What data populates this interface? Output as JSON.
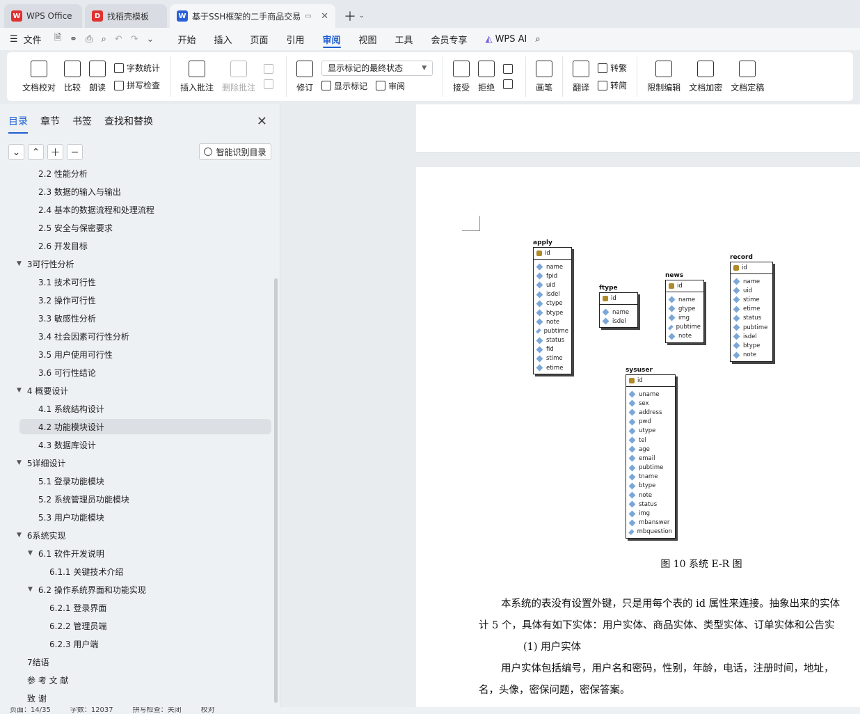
{
  "tabs": [
    {
      "label": "WPS Office",
      "logo": "W",
      "color": "#e0302f"
    },
    {
      "label": "找稻壳模板",
      "logo": "D",
      "color": "#e0302f"
    },
    {
      "label": "基于SSH框架的二手商品交易",
      "logo": "W",
      "color": "#2b5fd9"
    }
  ],
  "menubar": {
    "file": "文件",
    "items": [
      "开始",
      "插入",
      "页面",
      "引用",
      "审阅",
      "视图",
      "工具",
      "会员专享"
    ],
    "active": "审阅",
    "ai": "WPS AI"
  },
  "ribbon": {
    "doc_check": "文档校对",
    "compare": "比较",
    "read_aloud": "朗读",
    "word_count": "字数统计",
    "spell_check": "拼写检查",
    "insert_comment": "插入批注",
    "delete_comment": "删除批注",
    "revise": "修订",
    "display_select": "显示标记的最终状态",
    "show_marks": "显示标记",
    "review": "审阅",
    "accept": "接受",
    "reject": "拒绝",
    "pen": "画笔",
    "translate": "翻译",
    "to_trad": "转繁",
    "to_simp": "转简",
    "restrict_edit": "限制编辑",
    "encrypt": "文档加密",
    "finalize": "文档定稿"
  },
  "sidebar": {
    "tabs": [
      "目录",
      "章节",
      "书签",
      "查找和替换"
    ],
    "smart_button": "智能识别目录",
    "toc": [
      {
        "label": "2.2  性能分析",
        "level": 2
      },
      {
        "label": "2.3  数据的输入与输出",
        "level": 2
      },
      {
        "label": "2.4  基本的数据流程和处理流程",
        "level": 2
      },
      {
        "label": "2.5  安全与保密要求",
        "level": 2
      },
      {
        "label": "2.6  开发目标",
        "level": 2
      },
      {
        "label": "3可行性分析",
        "level": 1,
        "expanded": true
      },
      {
        "label": "3.1 技术可行性",
        "level": 2
      },
      {
        "label": "3.2 操作可行性",
        "level": 2
      },
      {
        "label": "3.3 敏感性分析",
        "level": 2
      },
      {
        "label": "3.4 社会因素可行性分析",
        "level": 2
      },
      {
        "label": "3.5 用户使用可行性",
        "level": 2
      },
      {
        "label": "3.6 可行性结论",
        "level": 2
      },
      {
        "label": "4  概要设计",
        "level": 1,
        "expanded": true
      },
      {
        "label": "4.1 系统结构设计",
        "level": 2
      },
      {
        "label": "4.2 功能模块设计",
        "level": 2,
        "selected": true
      },
      {
        "label": "4.3 数据库设计",
        "level": 2
      },
      {
        "label": "5详细设计",
        "level": 1,
        "expanded": true
      },
      {
        "label": "5.1 登录功能模块",
        "level": 2
      },
      {
        "label": "5.2 系统管理员功能模块",
        "level": 2
      },
      {
        "label": "5.3    用户功能模块",
        "level": 2
      },
      {
        "label": "6系统实现",
        "level": 1,
        "expanded": true
      },
      {
        "label": "6.1    软件开发说明",
        "level": 2,
        "expanded": true
      },
      {
        "label": "6.1.1    关键技术介绍",
        "level": 3
      },
      {
        "label": "6.2    操作系统界面和功能实现",
        "level": 2,
        "expanded": true
      },
      {
        "label": "6.2.1    登录界面",
        "level": 3
      },
      {
        "label": "6.2.2    管理员端",
        "level": 3
      },
      {
        "label": "6.2.3    用户端",
        "level": 3
      },
      {
        "label": "7结语",
        "level": 1
      },
      {
        "label": "参   考   文   献",
        "level": 1
      },
      {
        "label": "致           谢",
        "level": 1
      }
    ]
  },
  "diagram": {
    "entities": [
      {
        "name": "apply",
        "pk": "id",
        "fields": [
          "name",
          "fpid",
          "uid",
          "isdel",
          "ctype",
          "btype",
          "note",
          "pubtime",
          "status",
          "fid",
          "stime",
          "etime"
        ]
      },
      {
        "name": "ftype",
        "pk": "id",
        "fields": [
          "name",
          "isdel"
        ]
      },
      {
        "name": "news",
        "pk": "id",
        "fields": [
          "name",
          "gtype",
          "img",
          "pubtime",
          "note"
        ]
      },
      {
        "name": "record",
        "pk": "id",
        "fields": [
          "name",
          "uid",
          "stime",
          "etime",
          "status",
          "pubtime",
          "isdel",
          "btype",
          "note"
        ]
      },
      {
        "name": "sysuser",
        "pk": "id",
        "fields": [
          "uname",
          "sex",
          "address",
          "pwd",
          "utype",
          "tel",
          "age",
          "email",
          "pubtime",
          "tname",
          "btype",
          "note",
          "status",
          "img",
          "mbanswer",
          "mbquestion"
        ]
      }
    ],
    "caption": "图 10  系统 E-R 图"
  },
  "document": {
    "para1_line1": "本系统的表没有设置外键，只是用每个表的 id 属性来连接。抽象出来的实体",
    "para1_line2": "计 5 个，具体有如下实体：用户实体、商品实体、类型实体、订单实体和公告实",
    "heading1": "(1)   用户实体",
    "para2_line1": "用户实体包括编号，用户名和密码，性别，年龄，电话，注册时间，地址，",
    "para2_line2": "名，头像，密保问题，密保答案。"
  },
  "statusbar": {
    "page": "页面：14/35",
    "words": "字数：12037",
    "spell": "拼写检查：关闭",
    "proof": "校对"
  }
}
